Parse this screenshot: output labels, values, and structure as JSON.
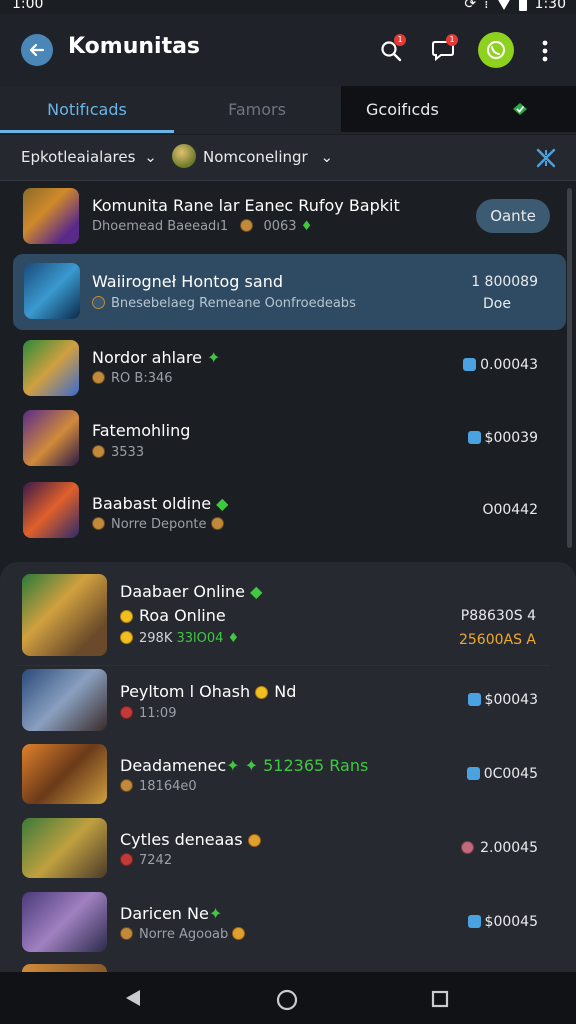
{
  "status": {
    "time": "1:00",
    "right_time": "1:30"
  },
  "appbar": {
    "title": "Komunitas",
    "notif_count": "1",
    "chat_count": "1"
  },
  "tabs": [
    {
      "label": "Notifıcads"
    },
    {
      "label": "Famors"
    },
    {
      "label": "Gcoifıcds"
    }
  ],
  "filters": {
    "left": "Epkotleaialares",
    "right": "Nomconelingr"
  },
  "colors": {
    "accent": "#6ab4e8",
    "highlight": "#2e4b63",
    "star": "#3ec93e",
    "whatsapp": "#8ed11f"
  },
  "items": [
    {
      "title": "Komunita Rane lar Eanec Rufoy Bapkit",
      "sub": "Dhoemead Baeeadı1",
      "sub2": "0063",
      "action": "Oante"
    },
    {
      "title": "Waiirogneł Hontog sand",
      "sub": "Bnesebelaeg Remeane Oonfroedeabs",
      "value1": "1 800089",
      "value2": "Doe"
    },
    {
      "title": "Nordor ahlare",
      "sub": "RO B:346",
      "value": "0.00043"
    },
    {
      "title": "Fatemohling",
      "sub": "3533",
      "value": "$00039"
    },
    {
      "title": "Baabast oldine",
      "sub": "Norre Deponte",
      "value": "O00442"
    },
    {
      "title": "Daabaer Online",
      "title2": "Roa Online",
      "sub": "298K",
      "sub2": "33lO04",
      "value1": "P88630S 4",
      "value2": "25600AS A"
    },
    {
      "title": "Peyltom l Ohash",
      "title_suffix": "Nd",
      "sub": "11:09",
      "value": "$00043"
    },
    {
      "title": "Deadamenec",
      "title_suffix": "512365 Rans",
      "sub": "18164e0",
      "value": "0C0045"
    },
    {
      "title": "Cytles deneaas",
      "sub": "7242",
      "value": "2.00045"
    },
    {
      "title": "Daricen Ne",
      "sub": "Norre Agooab",
      "value": "$00045"
    }
  ]
}
